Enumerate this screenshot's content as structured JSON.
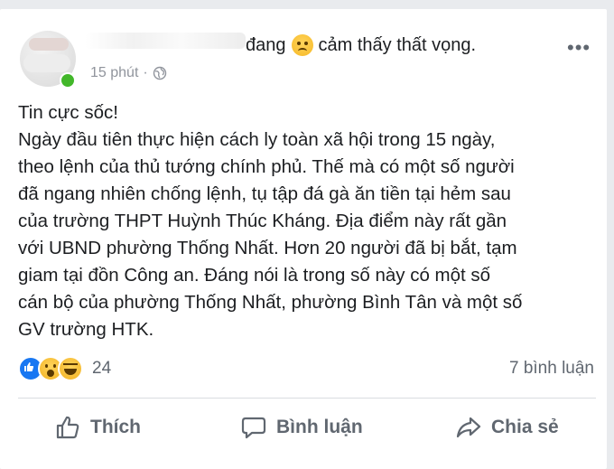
{
  "post": {
    "feeling": "đang",
    "feeling_suffix": "cảm thấy thất vọng.",
    "feeling_icon": "disappointed-face-icon",
    "time": "15 phút",
    "time_separator": "·",
    "privacy_icon": "globe-icon",
    "more_icon": "more-options-icon",
    "more_label": "•••",
    "text": "Tin cực sốc!\nNgày đầu tiên thực hiện cách ly toàn xã hội trong 15 ngày,\ntheo lệnh của thủ tướng chính phủ. Thế mà có một số người\nđã ngang nhiên chống lệnh, tụ tập đá gà ăn tiền tại hẻm sau\ncủa trường THPT Huỳnh Thúc Kháng. Địa điểm này rất gần\nvới UBND phường Thống Nhất. Hơn 20 người đã bị bắt, tạm\ngiam tại đồn Công an. Đáng nói là trong số này có một số\ncán bộ của phường Thống Nhất, phường Bình Tân và một số\nGV trường HTK."
  },
  "reactions": {
    "icons": [
      "like-reaction-icon",
      "wow-reaction-icon",
      "haha-reaction-icon"
    ],
    "count": "24",
    "comments": "7 bình luận"
  },
  "actions": {
    "like": "Thích",
    "comment": "Bình luận",
    "share": "Chia sẻ"
  },
  "colors": {
    "like_blue": "#1877f2",
    "online_green": "#42b72a",
    "secondary_text": "#606770"
  }
}
